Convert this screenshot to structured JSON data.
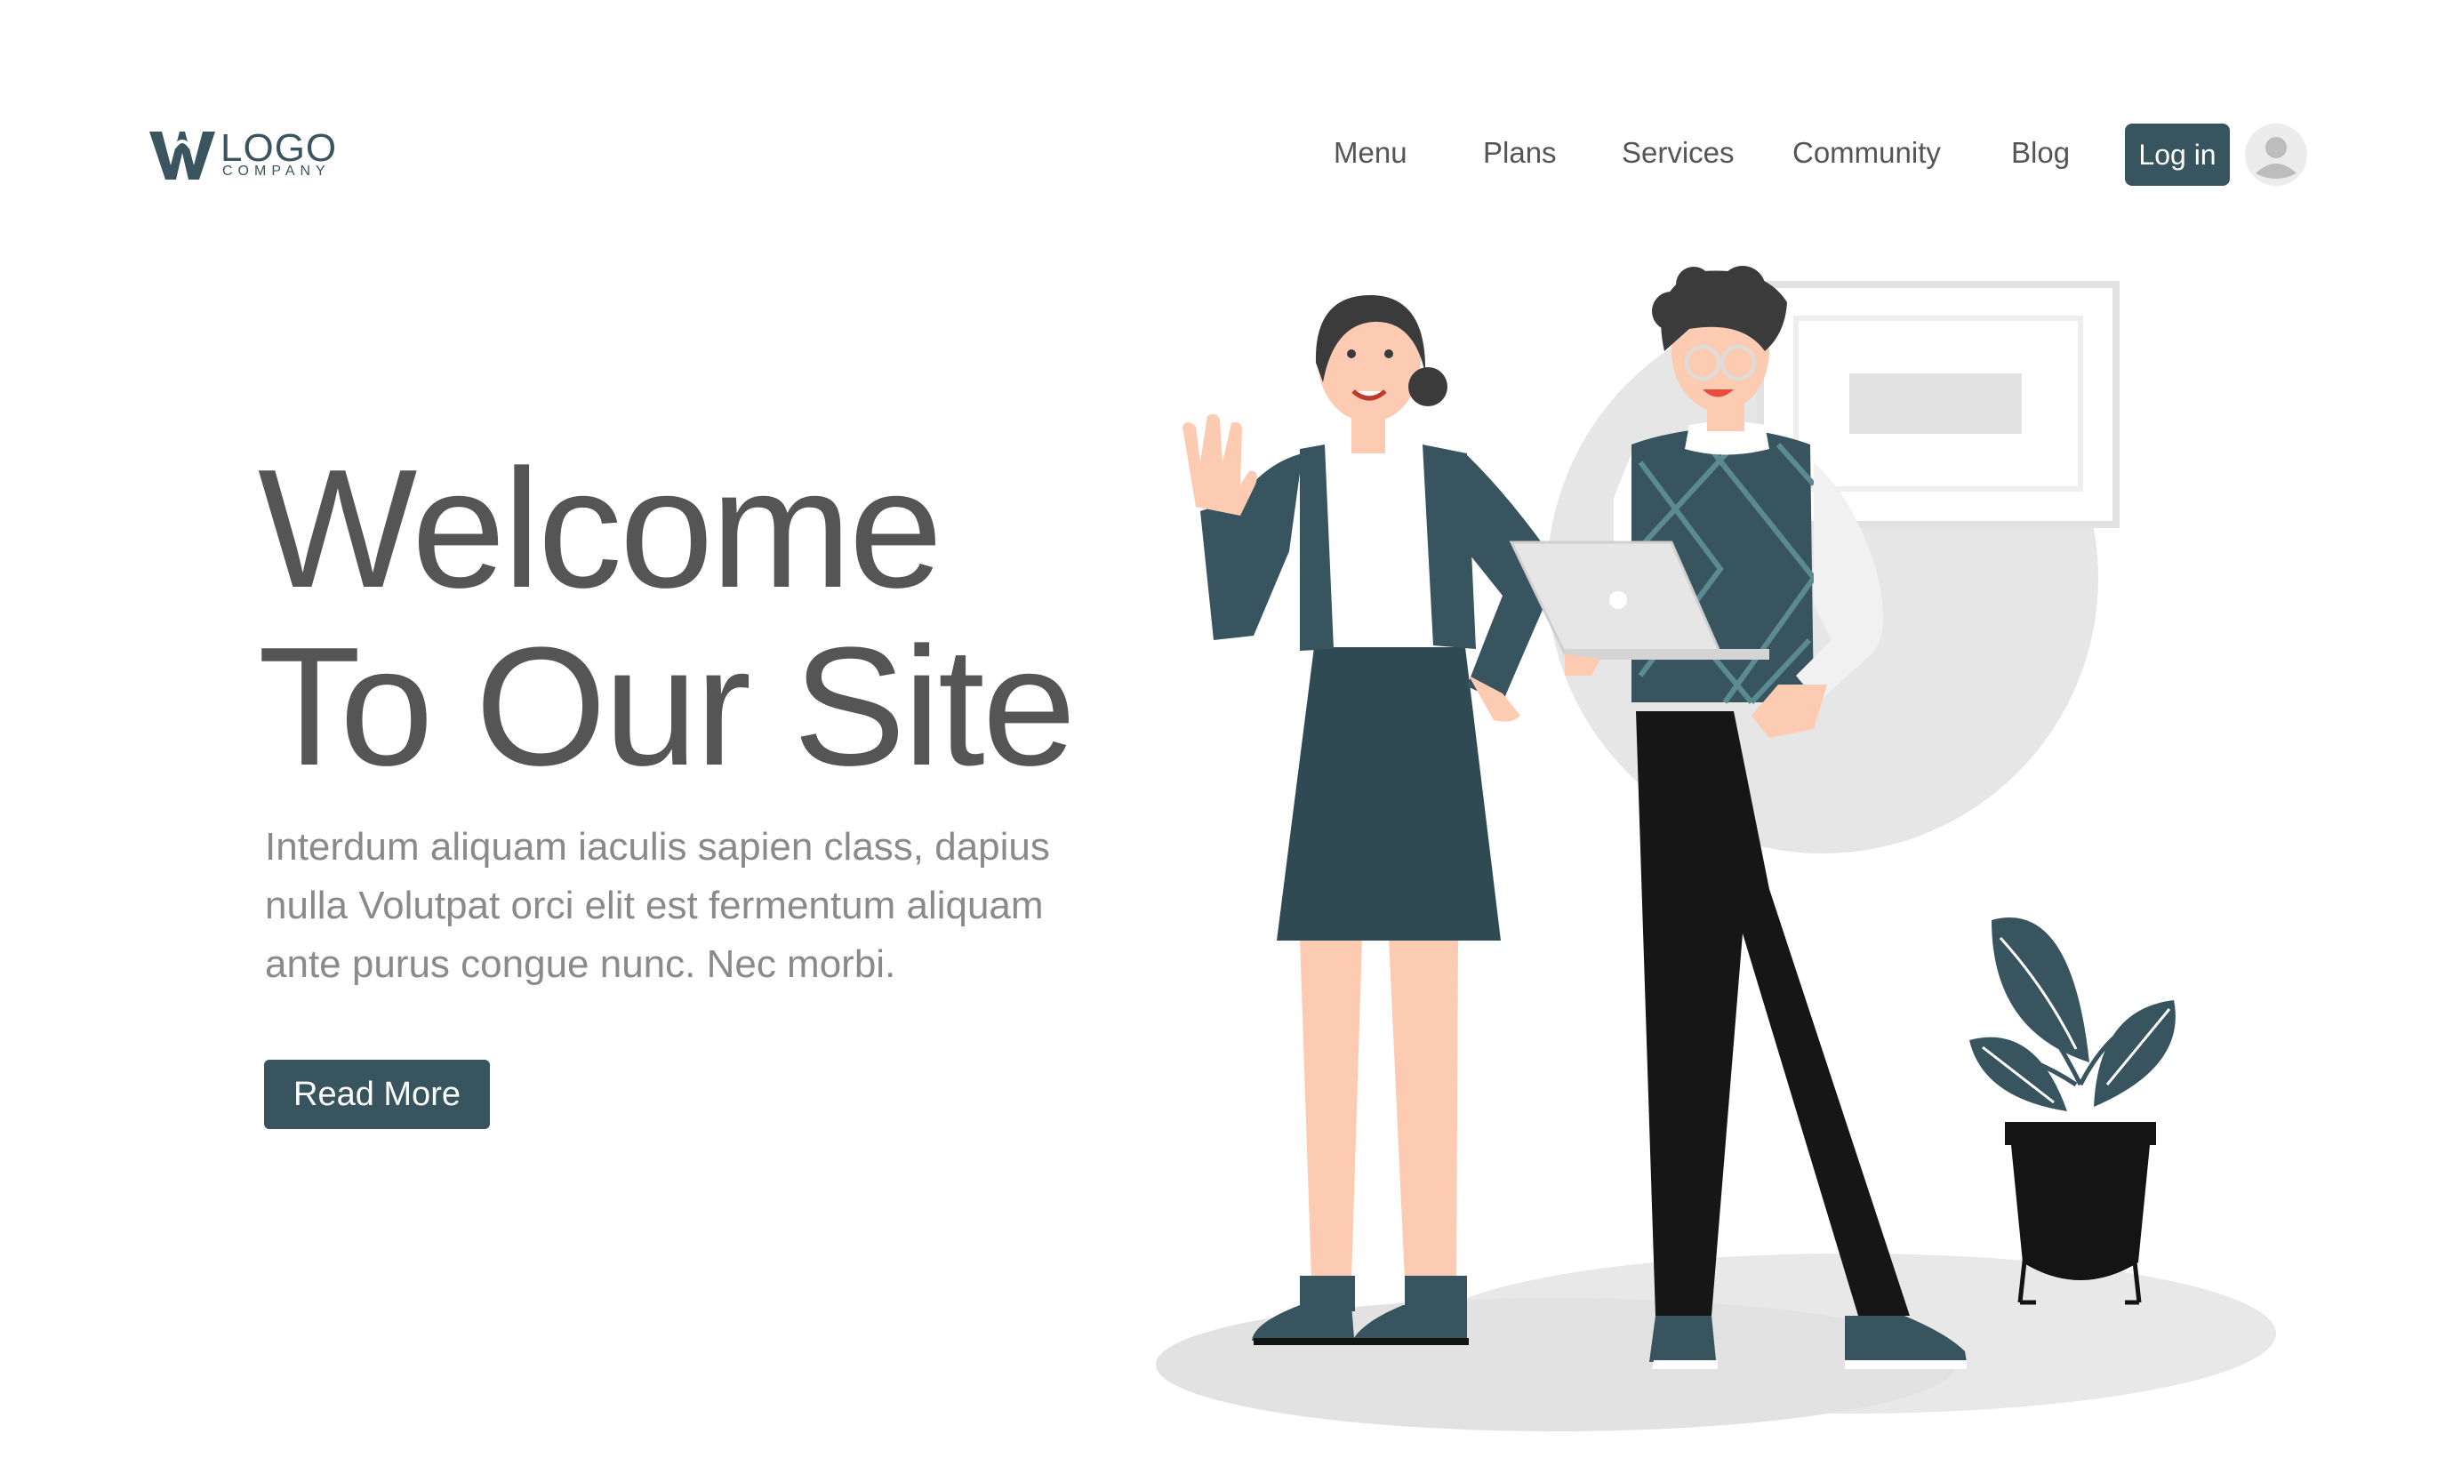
{
  "logo": {
    "mark": "W",
    "word": "LOGO",
    "sub": "COMPANY"
  },
  "nav": {
    "items": [
      {
        "label": "Menu"
      },
      {
        "label": "Plans"
      },
      {
        "label": "Services"
      },
      {
        "label": "Community"
      },
      {
        "label": "Blog"
      }
    ],
    "login_label": "Log in"
  },
  "hero": {
    "title_lines": [
      "Welcome",
      "To Our Site"
    ],
    "body_lines": [
      "Interdum aliquam iaculis sapien class, dapius",
      "nulla Volutpat orci elit est fermentum aliquam",
      "ante purus congue nunc. Nec morbi."
    ],
    "cta_label": "Read More"
  },
  "icons": {
    "avatar": "user-avatar-icon",
    "plant": "potted-plant"
  },
  "colors": {
    "primary": "#38545e",
    "text_dark": "#555555",
    "text_light": "#8a8a8a",
    "skin": "#fdcbb2",
    "neutral_light": "#e4e4e4"
  }
}
